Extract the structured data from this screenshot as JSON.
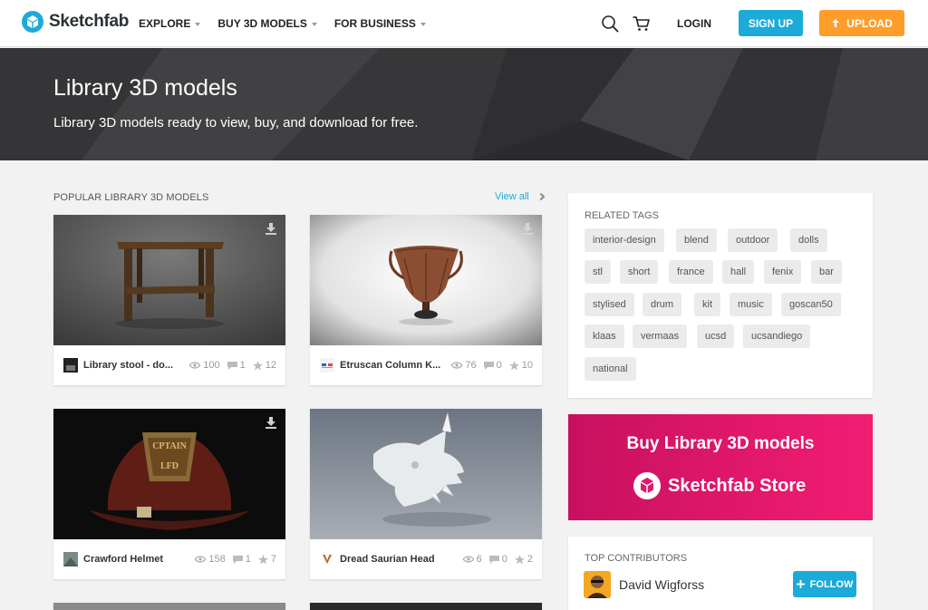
{
  "header": {
    "logo_text": "Sketchfab",
    "nav": [
      {
        "label": "EXPLORE"
      },
      {
        "label": "BUY 3D MODELS"
      },
      {
        "label": "FOR BUSINESS"
      }
    ],
    "login": "LOGIN",
    "signup": "SIGN UP",
    "upload": "UPLOAD"
  },
  "hero": {
    "title": "Library 3D models",
    "subtitle": "Library 3D models ready to view, buy, and download for free."
  },
  "popular": {
    "title": "POPULAR LIBRARY 3D MODELS",
    "view_all": "View all",
    "cards": [
      {
        "name": "Library stool - do...",
        "views": "100",
        "comments": "1",
        "likes": "12"
      },
      {
        "name": "Etruscan Column K...",
        "views": "76",
        "comments": "0",
        "likes": "10"
      },
      {
        "name": "Crawford Helmet",
        "views": "158",
        "comments": "1",
        "likes": "7"
      },
      {
        "name": "Dread Saurian Head",
        "views": "6",
        "comments": "0",
        "likes": "2"
      }
    ]
  },
  "related_tags": {
    "title": "RELATED TAGS",
    "tags": [
      "interior-design",
      "blend",
      "outdoor",
      "dolls",
      "stl",
      "short",
      "france",
      "hall",
      "fenix",
      "bar",
      "stylised",
      "drum",
      "kit",
      "music",
      "goscan50",
      "klaas",
      "vermaas",
      "ucsd",
      "ucsandiego",
      "national"
    ]
  },
  "store": {
    "title": "Buy Library 3D models",
    "brand": "Sketchfab Store"
  },
  "contributors": {
    "title": "TOP CONTRIBUTORS",
    "name": "David Wigforss",
    "follow": "FOLLOW"
  },
  "colors": {
    "accent_blue": "#1caad9",
    "upload_orange": "#ff9d2b",
    "store_pink": "#e2186a"
  },
  "icons": [
    "sketchfab-logo-icon",
    "search-icon",
    "cart-icon",
    "upload-arrow-icon",
    "download-icon",
    "eye-icon",
    "comment-icon",
    "star-icon",
    "plus-icon"
  ]
}
